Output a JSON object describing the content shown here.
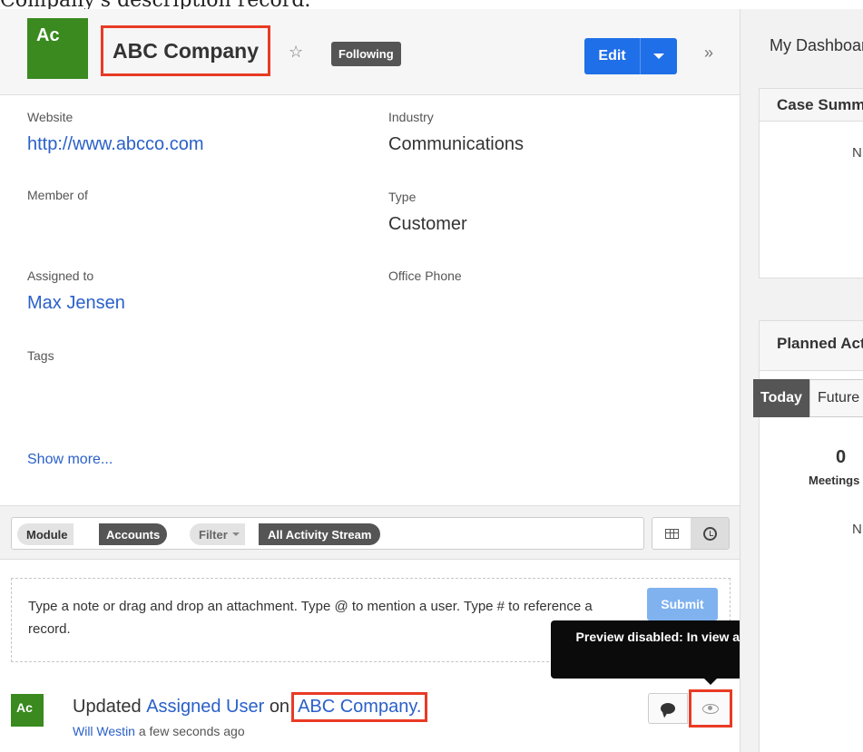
{
  "top_cut_text": "Company's description record.",
  "record": {
    "avatar_initials": "Ac",
    "name": "ABC Company",
    "following_label": "Following",
    "edit_label": "Edit"
  },
  "fields": {
    "website_label": "Website",
    "website_value": "http://www.abcco.com",
    "industry_label": "Industry",
    "industry_value": "Communications",
    "member_of_label": "Member of",
    "type_label": "Type",
    "type_value": "Customer",
    "assigned_to_label": "Assigned to",
    "assigned_to_value": "Max Jensen",
    "office_phone_label": "Office Phone",
    "tags_label": "Tags",
    "show_more": "Show more..."
  },
  "activity_filter": {
    "module_label": "Module",
    "module_value": "Accounts",
    "filter_label": "Filter",
    "filter_value": "All Activity Stream"
  },
  "composer": {
    "placeholder": "Type a note or drag and drop an attachment. Type @ to mention a user. Type # to reference a record.",
    "submit_label": "Submit"
  },
  "tooltip": {
    "text": "Preview disabled: In view as current record"
  },
  "activity": {
    "avatar_initials": "Ac",
    "prefix": "Updated",
    "field_link": "Assigned User",
    "middle": "on",
    "record_link": "ABC Company",
    "suffix": ".",
    "author": "Will Westin",
    "time": "a few seconds ago"
  },
  "dashboard": {
    "title": "My Dashboard",
    "case_summary_title": "Case Summary",
    "case_summary_text": "N",
    "planned_title": "Planned Activities",
    "tab_today": "Today",
    "tab_future": "Future",
    "meetings_count": "0",
    "meetings_label": "Meetings",
    "planned_text": "N"
  },
  "colors": {
    "avatar_green": "#3a8a1f",
    "edit_blue": "#1f6fe8",
    "link_blue": "#2a60c9",
    "highlight_red": "#e93a25"
  }
}
